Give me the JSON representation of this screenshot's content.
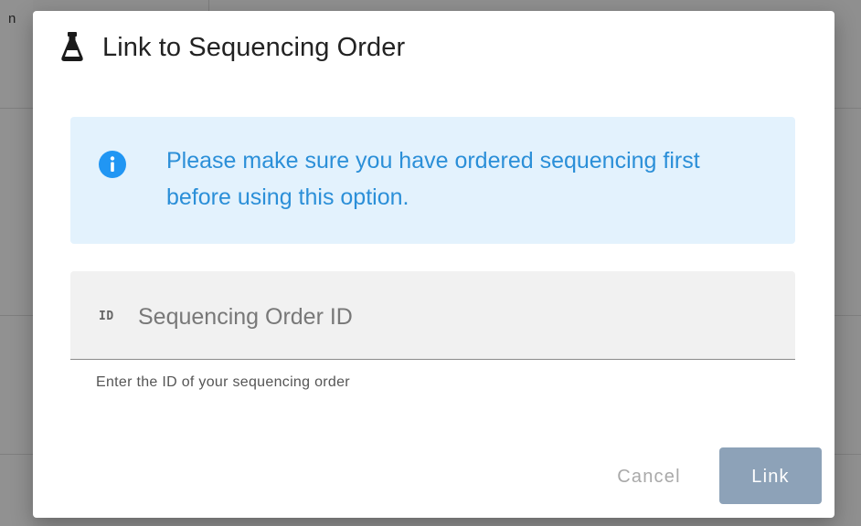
{
  "background": {
    "partial_text": "n"
  },
  "dialog": {
    "title": "Link to Sequencing Order",
    "title_icon": "flask-icon",
    "alert": {
      "icon": "info-icon",
      "text": "Please make sure you have ordered sequencing first before using this option."
    },
    "field": {
      "prefix": "ID",
      "placeholder": "Sequencing Order ID",
      "value": "",
      "hint": "Enter the ID of your sequencing order"
    },
    "actions": {
      "cancel_label": "Cancel",
      "link_label": "Link"
    }
  },
  "colors": {
    "alert_background": "#e3f2fd",
    "alert_text": "#2b8fd8",
    "info_icon": "#2196f3",
    "link_button": "#8da2b8",
    "cancel_text": "#a9a9a9",
    "field_background": "#f1f1f1"
  }
}
